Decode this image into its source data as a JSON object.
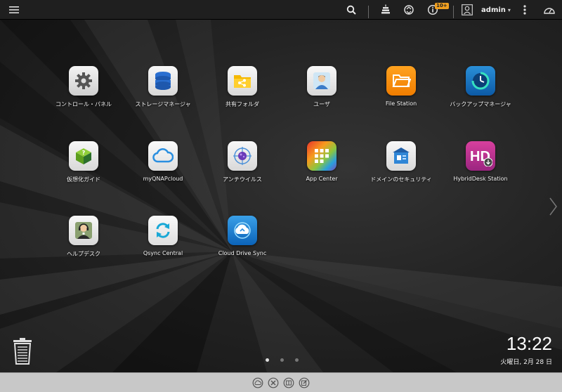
{
  "topbar": {
    "notification_badge": "10+",
    "user": {
      "name": "admin",
      "caret": "▾"
    }
  },
  "apps": [
    {
      "label": "コントロール・パネル",
      "icon": "gear-icon"
    },
    {
      "label": "ストレージマネージャ",
      "icon": "database-icon"
    },
    {
      "label": "共有フォルダ",
      "icon": "shared-folder-icon"
    },
    {
      "label": "ユーザ",
      "icon": "user-icon"
    },
    {
      "label": "File Station",
      "icon": "folder-icon"
    },
    {
      "label": "バックアップマネージャ",
      "icon": "backup-clock-icon"
    },
    {
      "label": "仮想化ガイド",
      "icon": "virtual-cube-icon"
    },
    {
      "label": "myQNAPcloud",
      "icon": "cloud-icon"
    },
    {
      "label": "アンチウイルス",
      "icon": "antivirus-icon"
    },
    {
      "label": "App Center",
      "icon": "app-grid-icon"
    },
    {
      "label": "ドメインのセキュリティ",
      "icon": "domain-security-icon"
    },
    {
      "label": "HybridDesk Station",
      "icon": "hd-station-icon"
    },
    {
      "label": "ヘルプデスク",
      "icon": "headset-person-icon"
    },
    {
      "label": "Qsync Central",
      "icon": "sync-icon"
    },
    {
      "label": "Cloud Drive Sync",
      "icon": "cloud-sync-icon"
    }
  ],
  "clock": {
    "time": "13:22",
    "date": "火曜日, 2月 28 日"
  },
  "pages": {
    "count": 3,
    "active": 1
  },
  "colors": {
    "topbar": "#1f1f1f",
    "dock": "#c8c8c8",
    "badge": "#f0a020"
  }
}
